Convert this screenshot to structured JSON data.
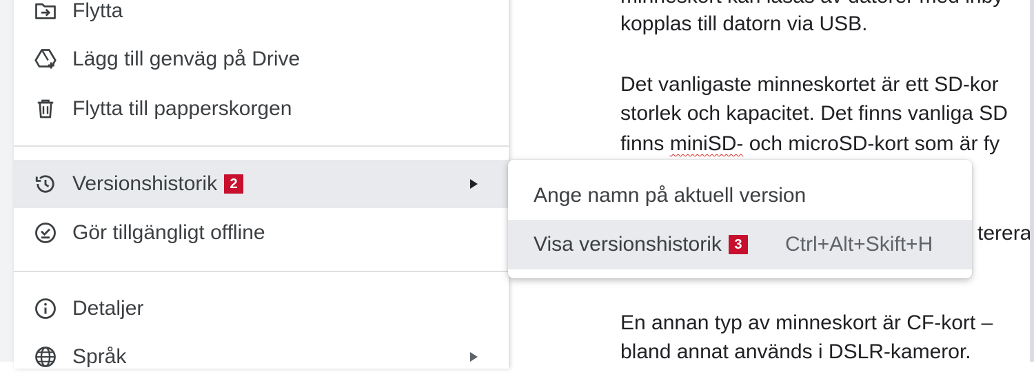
{
  "menu": {
    "items": [
      {
        "label": "Flytta",
        "icon": "move-folder-icon"
      },
      {
        "label": "Lägg till genväg på Drive",
        "icon": "drive-shortcut-icon"
      },
      {
        "label": "Flytta till papperskorgen",
        "icon": "trash-icon"
      },
      {
        "label": "Versionshistorik",
        "icon": "history-icon",
        "badge": "2"
      },
      {
        "label": "Gör tillgängligt offline",
        "icon": "offline-check-icon"
      },
      {
        "label": "Detaljer",
        "icon": "info-icon"
      },
      {
        "label": "Språk",
        "icon": "globe-icon"
      }
    ]
  },
  "submenu": {
    "items": [
      {
        "label": "Ange namn på aktuell version"
      },
      {
        "label": "Visa versionshistorik",
        "badge": "3",
        "shortcut": "Ctrl+Alt+Skift+H"
      }
    ]
  },
  "document": {
    "lines": [
      "minneskort kan läsas av datorer med inby",
      "kopplas till datorn via USB.",
      "Det vanligaste minneskortet är ett SD-kor",
      "storlek och kapacitet. Det finns vanliga SD",
      "finns ",
      "miniSD-",
      " och microSD-kort som är fy",
      "tereras",
      "En annan typ av minneskort är CF-kort –",
      "bland annat används i DSLR-kameror."
    ]
  },
  "colors": {
    "badge": "#c8102e",
    "highlight": "#e8eaed"
  }
}
